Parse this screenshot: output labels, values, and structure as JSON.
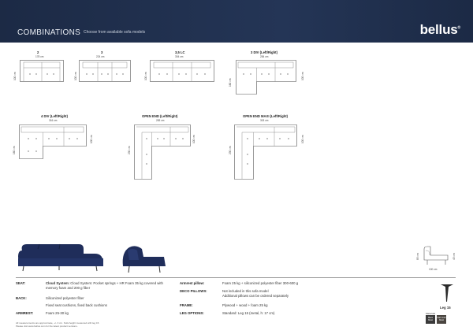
{
  "header": {
    "title": "COMBINATIONS",
    "subtitle": "Choose from available sofa models",
    "brand": "bellus",
    "brand_mark": "®"
  },
  "models": [
    {
      "name": "2",
      "width": "178 cm",
      "depth": "100 cm"
    },
    {
      "name": "3",
      "width": "224 cm",
      "depth": "100 cm"
    },
    {
      "name": "3,5 LC",
      "width": "304 cm",
      "depth": "100 cm"
    },
    {
      "name": "3 DIV (Left/Right)",
      "width": "284 cm",
      "depth": "100 cm",
      "depth2": "160 cm"
    },
    {
      "name": "4 DIV (Left/Right)",
      "width": "316 cm",
      "depth": "100 cm",
      "depth2": "160 cm"
    },
    {
      "name": "OPEN END (Left/Right)",
      "width": "283 cm",
      "depth": "100 cm",
      "depth2": "230 cm"
    },
    {
      "name": "OPEN END MAXI (Left/Right)",
      "width": "303 cm",
      "depth": "100 cm",
      "depth2": "230 cm"
    }
  ],
  "side_view": {
    "height": "83 cm",
    "seat_height": "45 cm",
    "depth": "100 cm"
  },
  "specs": {
    "left": [
      {
        "label": "SEAT:",
        "value": [
          "Cloud System: Pocket springs + HR Foam 35 kg covered with",
          "memory foam and 200 g fiber"
        ]
      },
      {
        "label": "BACK:",
        "value": [
          "Siliconized polyester fiber",
          "Fixed seat cushions, fixed back cushions"
        ]
      },
      {
        "label": "ARMREST:",
        "value": [
          "Foam 25-30 kg"
        ]
      }
    ],
    "right": [
      {
        "label": "Armrest pillow:",
        "value": [
          "Foam 25 kg + siliconized polyester fiber 300-600 g"
        ]
      },
      {
        "label": "DECO PILLOWS:",
        "value": [
          "Not included in this sofa model",
          "Additional pillows can be ordered separately"
        ]
      },
      {
        "label": "FRAME:",
        "value": [
          "Plywood + wood + foam 25 kg"
        ]
      },
      {
        "label": "LEG OPTIONS:",
        "value": [
          "Standard: Leg 15 (metal, h: 17 cm)"
        ]
      }
    ]
  },
  "leg": {
    "name": "Leg 15",
    "materials_label": "Materials",
    "swatch1": "Black Metal",
    "swatch2": "Dark Gold Metal"
  },
  "footnote": [
    "All measurements are approximate, +/- 3 cm. Sofa height measured with leg 15.",
    "Please visit www.bellus.com for the latest product versions."
  ],
  "colors": {
    "header": "#1e2c48",
    "fabric": "#1f2d5a",
    "leg_black": "#2b2b2b",
    "leg_gold": "#6a5a3a"
  }
}
